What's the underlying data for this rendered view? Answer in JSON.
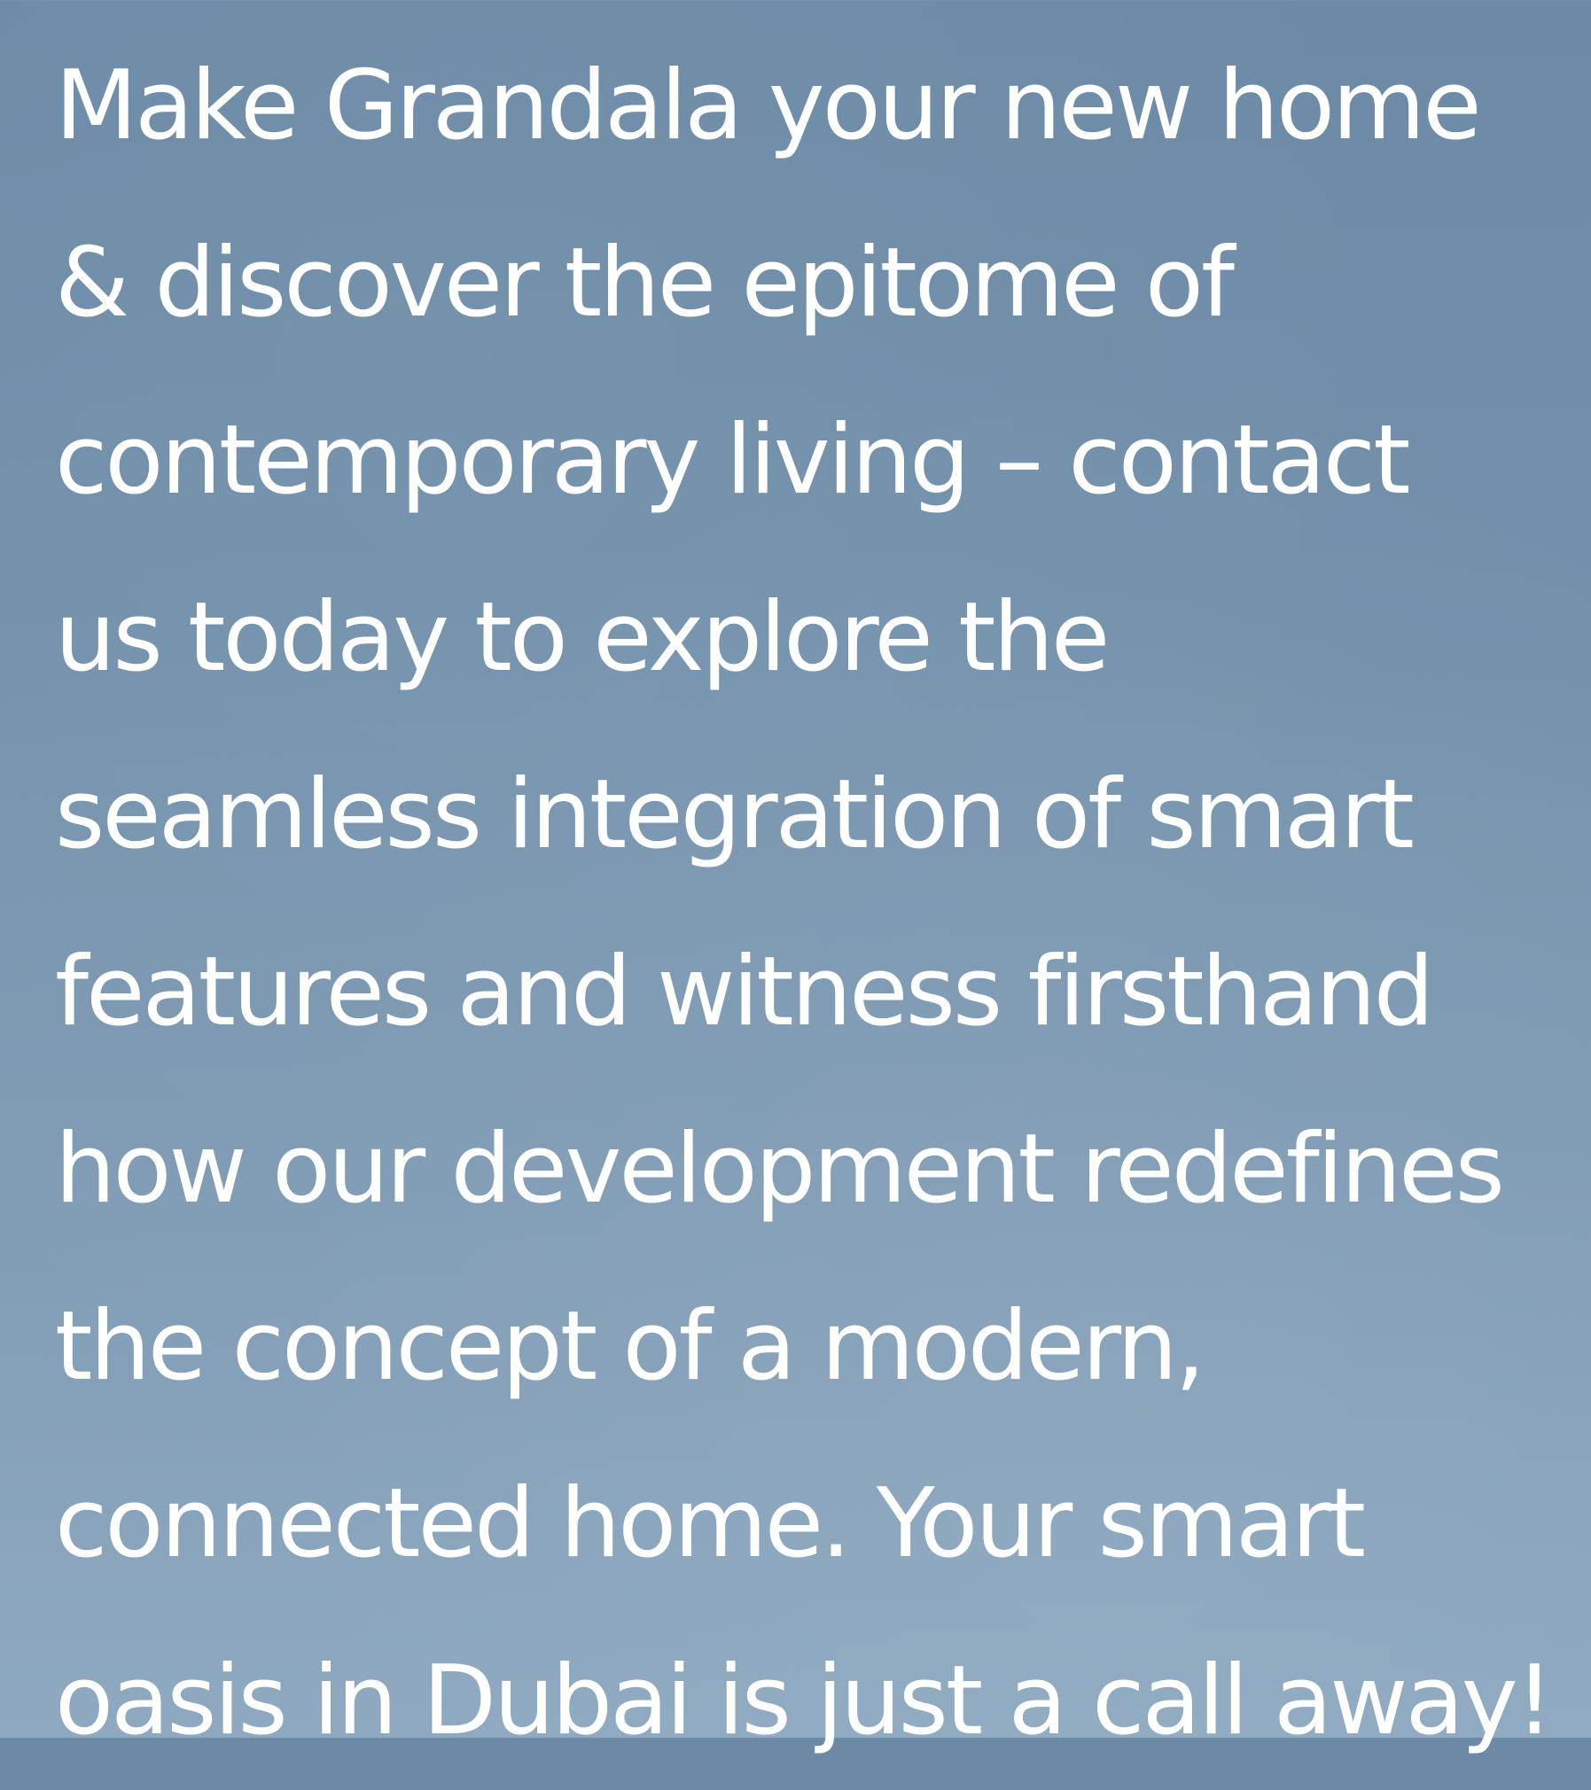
{
  "background": {
    "top_color": "#6c8aa6",
    "bottom_color": "#8ea9c0",
    "text_color": "#ffffff"
  },
  "paragraph": {
    "lines": [
      "Make Grandala your new home",
      "& discover the epitome of",
      "contemporary living – contact",
      "us today to explore the",
      "seamless integration of smart",
      "features and witness firsthand",
      "how our development redefines",
      "the concept of a modern,",
      "connected home. Your smart",
      "oasis in Dubai is just a call away!"
    ]
  }
}
